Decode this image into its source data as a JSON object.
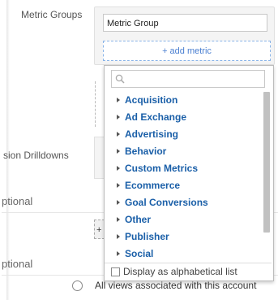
{
  "labels": {
    "metric_groups": "Metric Groups",
    "dimension_drilldowns": "sion Drilldowns",
    "optional_1": "ptional",
    "optional_2": "ptional"
  },
  "metric_group": {
    "value": "Metric Group",
    "add_metric": "+ add metric"
  },
  "small_button": "+",
  "dropdown": {
    "search_placeholder": "",
    "items": [
      "Acquisition",
      "Ad Exchange",
      "Advertising",
      "Behavior",
      "Custom Metrics",
      "Ecommerce",
      "Goal Conversions",
      "Other",
      "Publisher",
      "Social"
    ],
    "footer_label": "Display as alphabetical list",
    "alphabetical": false
  },
  "views": {
    "all_label": "All views associated with this account",
    "selected": false
  },
  "colors": {
    "link_blue": "#1a5fa8",
    "add_metric_blue": "#4a7fd1"
  }
}
